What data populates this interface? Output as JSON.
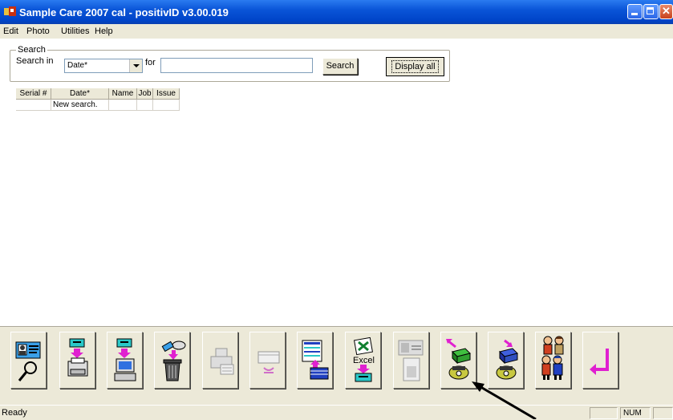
{
  "window": {
    "title": "Sample Care 2007 cal - positivID v3.00.019"
  },
  "menu": {
    "items": [
      "Edit",
      "Photo",
      "Utilities",
      "Help"
    ]
  },
  "search": {
    "group_label": "Search",
    "search_in_label": "Search in",
    "field_value": "Date*",
    "for_label": "for",
    "query_value": "",
    "search_button": "Search",
    "display_all_button": "Display all"
  },
  "grid": {
    "columns": [
      "Serial #",
      "Date*",
      "Name",
      "Job",
      "Issue"
    ],
    "rows": [
      [
        "",
        "New search.",
        "",
        "",
        ""
      ]
    ]
  },
  "toolbar": {
    "buttons": [
      {
        "icon": "id-card-search-icon",
        "enabled": true
      },
      {
        "icon": "print-to-printer-icon",
        "enabled": true
      },
      {
        "icon": "send-to-computer-icon",
        "enabled": true
      },
      {
        "icon": "delete-trash-icon",
        "enabled": true
      },
      {
        "icon": "printer-disabled-icon",
        "enabled": false
      },
      {
        "icon": "undo-table-disabled-icon",
        "enabled": false
      },
      {
        "icon": "table-layout-icon",
        "enabled": true
      },
      {
        "icon": "excel-export-icon",
        "enabled": true,
        "label": "Excel"
      },
      {
        "icon": "id-photo-disabled-icon",
        "enabled": false
      },
      {
        "icon": "phone-upload-icon",
        "enabled": true
      },
      {
        "icon": "phone-download-icon",
        "enabled": true
      },
      {
        "icon": "people-group-icon",
        "enabled": true
      },
      {
        "icon": "enter-return-icon",
        "enabled": true
      }
    ]
  },
  "status": {
    "text": "Ready",
    "num": "NUM"
  }
}
